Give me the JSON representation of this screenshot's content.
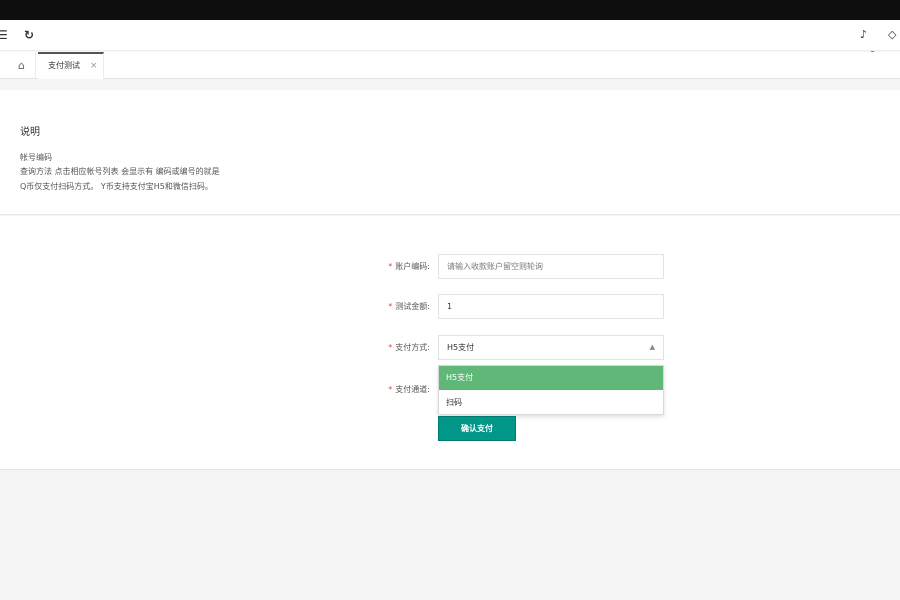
{
  "header": {
    "menu_icon": "menu-icon",
    "refresh_icon": "refresh-icon",
    "notification_icon": "bell-icon",
    "tag_icon": "tag-icon"
  },
  "tabs": {
    "home_icon": "home-icon",
    "active_label": "支付测试",
    "close_glyph": "×"
  },
  "info": {
    "title": "说明",
    "lines": [
      "帐号编码",
      "查询方法 点击相应帐号列表 会显示有 编码或编号的就是",
      "Q币仅支付扫码方式。 Y币支持支付宝H5和微信扫码。"
    ]
  },
  "form": {
    "fields": [
      {
        "label": "账户编码:",
        "placeholder": "请输入收款账户留空则轮询"
      },
      {
        "label": "测试金额:",
        "value": "1"
      },
      {
        "label": "支付方式:",
        "value": "H5支付"
      },
      {
        "label": "支付通道:"
      }
    ],
    "dropdown_options": [
      "H5支付",
      "扫码"
    ],
    "submit_label": "确认支付"
  },
  "colors": {
    "primary_button": "#009688",
    "selected_option": "#5fb878",
    "required_star": "#e84b3c"
  }
}
